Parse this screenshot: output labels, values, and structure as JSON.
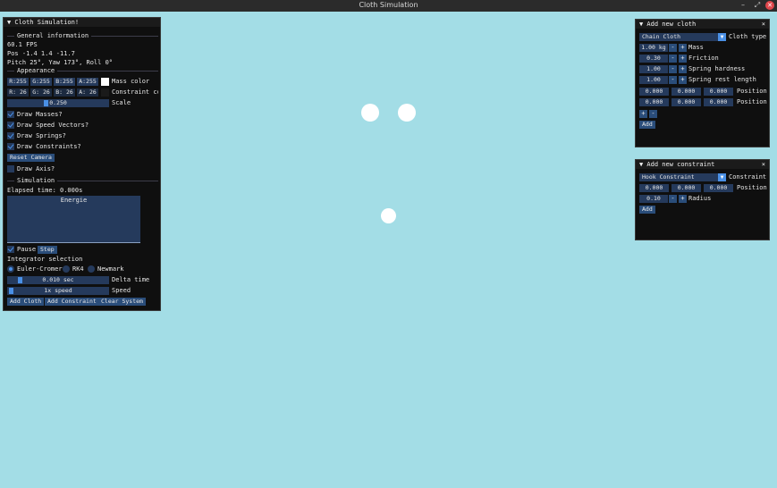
{
  "window": {
    "title": "Cloth Simulation",
    "min": "–",
    "max": "⤢",
    "close": "✕"
  },
  "left": {
    "header": "▼ Cloth Simulation!",
    "general_label": "General information",
    "fps": "60.1 FPS",
    "pos": "Pos -1.4 1.4 -11.7",
    "angles": "Pitch 25°, Yaw 173°, Roll 0°",
    "appearance_label": "Appearance",
    "mass_rgba": [
      "R:255",
      "G:255",
      "B:255",
      "A:255"
    ],
    "mass_color_label": "Mass color",
    "constraint_rgba": [
      "R: 26",
      "G: 26",
      "B: 26",
      "A: 26"
    ],
    "constraint_color_label": "Constraint color",
    "scale_value": "0.250",
    "scale_label": "Scale",
    "checks": [
      {
        "label": "Draw Masses?",
        "on": true
      },
      {
        "label": "Draw Speed Vectors?",
        "on": true
      },
      {
        "label": "Draw Springs?",
        "on": true
      },
      {
        "label": "Draw Constraints?",
        "on": true
      }
    ],
    "reset_camera": "Reset Camera",
    "draw_axis": "Draw Axis?",
    "simulation_label": "Simulation",
    "elapsed": "Elapsed time: 0.000s",
    "energie": "Energie",
    "pause": "Pause",
    "step": "Step",
    "integrator_label": "Integrator selection",
    "integrators": [
      "Euler-Cromer",
      "RK4",
      "Newmark"
    ],
    "dt_value": "0.010 sec",
    "dt_label": "Delta time",
    "speed_value": "1x speed",
    "speed_label": "Speed",
    "add_cloth": "Add Cloth",
    "add_constraint": "Add Constraint",
    "clear_system": "Clear System"
  },
  "cloth": {
    "header": "▼ Add new cloth",
    "close": "×",
    "type_value": "Chain Cloth",
    "type_label": "Cloth type",
    "params": [
      {
        "value": "1.00 kg",
        "label": "Mass"
      },
      {
        "value": "0.30",
        "label": "Friction"
      },
      {
        "value": "1.00",
        "label": "Spring hardness"
      },
      {
        "value": "1.00",
        "label": "Spring rest length"
      }
    ],
    "positions": [
      {
        "vals": [
          "0.000",
          "0.000",
          "0.000"
        ],
        "label": "Position"
      },
      {
        "vals": [
          "0.000",
          "0.000",
          "0.000"
        ],
        "label": "Position"
      }
    ],
    "plus": "+",
    "minus": "-",
    "add": "Add"
  },
  "constraint": {
    "header": "▼ Add new constraint",
    "close": "×",
    "type_value": "Hook Constraint",
    "type_label": "Constraint type",
    "pos_vals": [
      "0.000",
      "0.000",
      "0.000"
    ],
    "pos_label": "Position",
    "radius_value": "0.10",
    "radius_label": "Radius",
    "add": "Add"
  }
}
